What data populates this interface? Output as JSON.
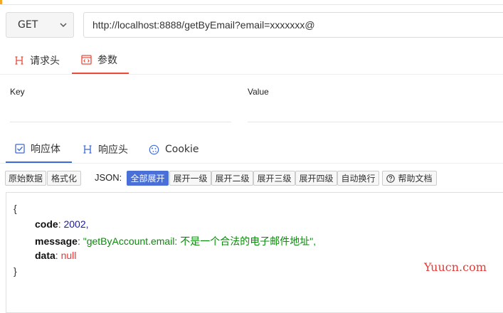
{
  "request": {
    "method": "GET",
    "url": "http://localhost:8888/getByEmail?email=xxxxxxx@"
  },
  "request_tabs": [
    {
      "label": "请求头",
      "icon": "h-heading-icon",
      "active": false
    },
    {
      "label": "参数",
      "icon": "code-window-icon",
      "active": true
    }
  ],
  "params": {
    "key_header": "Key",
    "value_header": "Value"
  },
  "response_tabs": [
    {
      "label": "响应体",
      "icon": "checkbox-icon",
      "active": true
    },
    {
      "label": "响应头",
      "icon": "h-heading-icon",
      "active": false
    },
    {
      "label": "Cookie",
      "icon": "cookie-icon",
      "active": false
    }
  ],
  "toolbar": {
    "raw": "原始数据",
    "format": "格式化",
    "json_label": "JSON:",
    "expand_all": "全部展开",
    "expand_1": "展开一级",
    "expand_2": "展开二级",
    "expand_3": "展开三级",
    "expand_4": "展开四级",
    "auto_wrap": "自动换行",
    "help": "帮助文档"
  },
  "response": {
    "open_brace": "{",
    "close_brace": "}",
    "fields": [
      {
        "key": "code",
        "value": "2002,",
        "type": "number"
      },
      {
        "key": "message",
        "value": "\"getByAccount.email: 不是一个合法的电子邮件地址\",",
        "type": "string"
      },
      {
        "key": "data",
        "value": "null",
        "type": "null"
      }
    ]
  },
  "watermark": "Yuucn.com",
  "colors": {
    "accent_red": "#e74c3c",
    "accent_blue": "#3f6ad8",
    "button_active": "#4a6fd6"
  }
}
